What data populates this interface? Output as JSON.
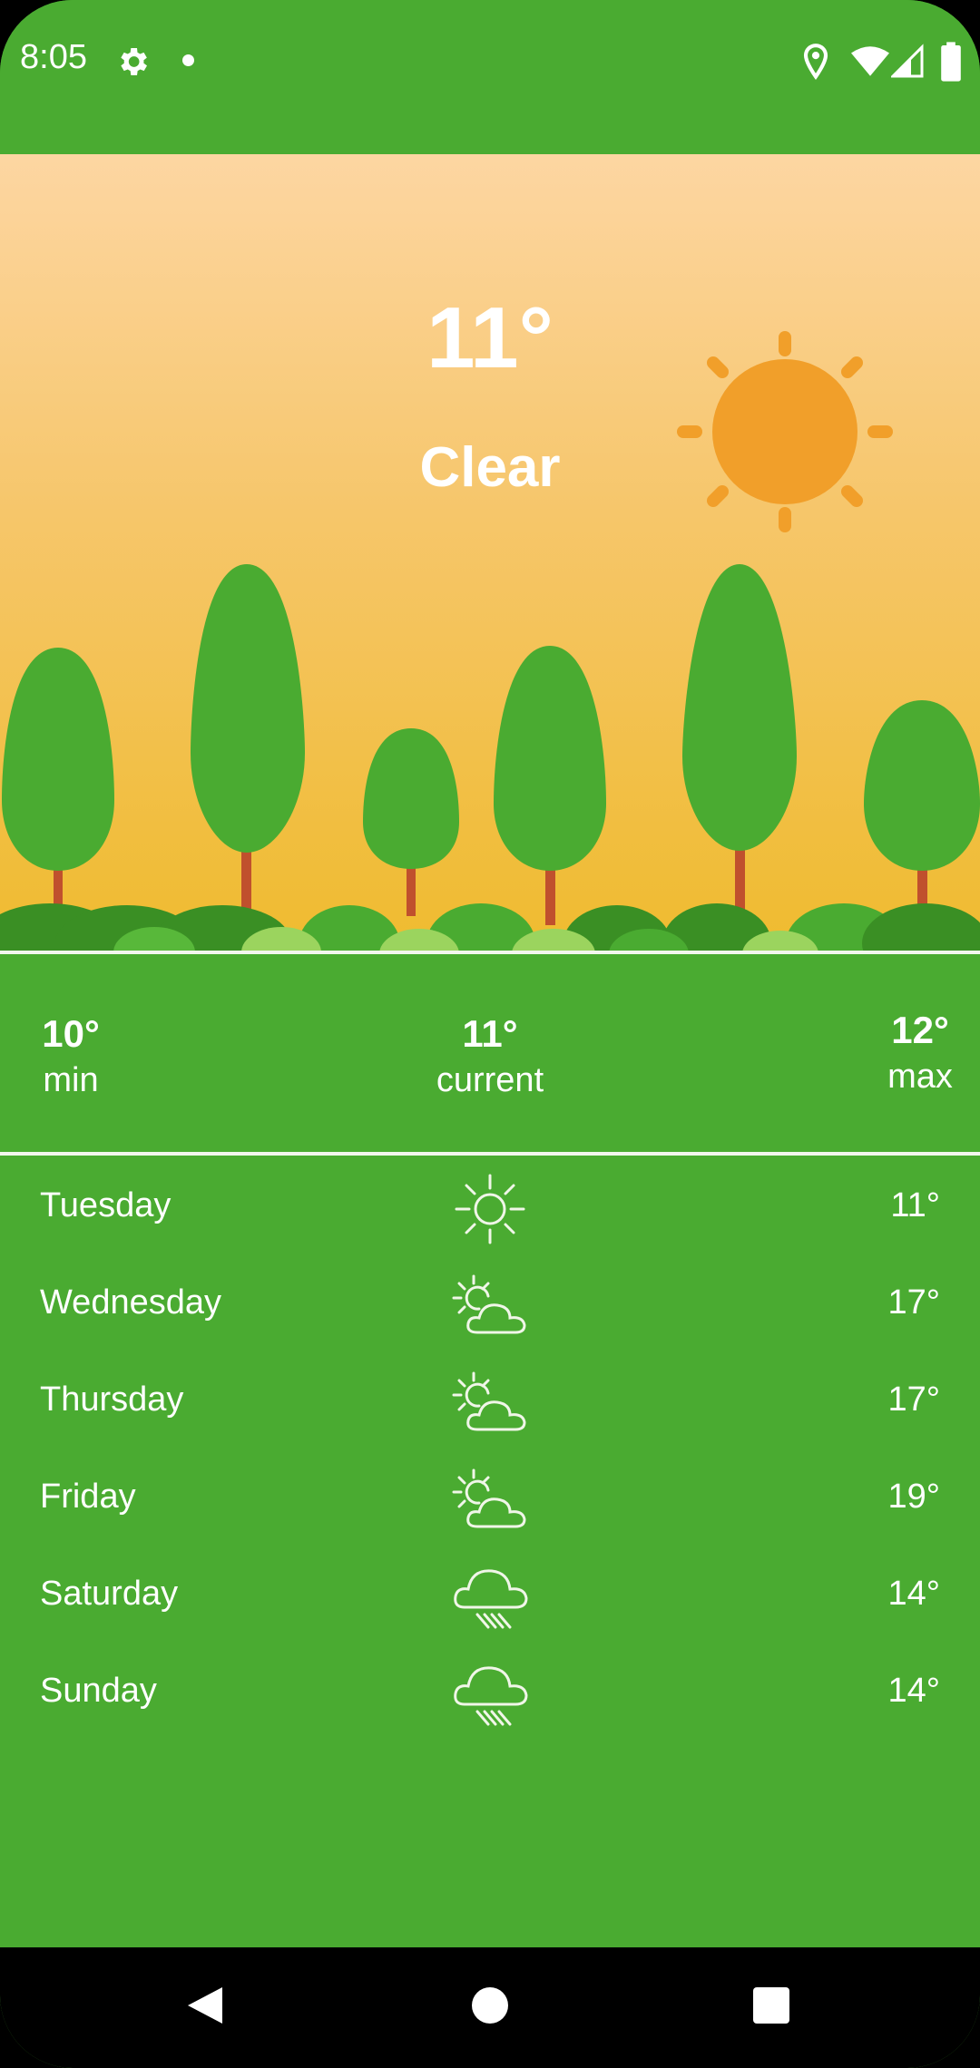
{
  "status_bar": {
    "time": "8:05",
    "icons": [
      "gear-icon",
      "notification-dot-icon",
      "location-icon",
      "wifi-icon",
      "signal-icon",
      "battery-icon"
    ]
  },
  "current": {
    "temperature": "11°",
    "condition": "Clear",
    "condition_icon": "sun-icon"
  },
  "summary": {
    "min_value": "10°",
    "min_label": "min",
    "current_value": "11°",
    "current_label": "current",
    "max_value": "12°",
    "max_label": "max"
  },
  "forecast": [
    {
      "day": "Tuesday",
      "icon": "sun-icon",
      "temp": "11°"
    },
    {
      "day": "Wednesday",
      "icon": "partly-cloudy-icon",
      "temp": "17°"
    },
    {
      "day": "Thursday",
      "icon": "partly-cloudy-icon",
      "temp": "17°"
    },
    {
      "day": "Friday",
      "icon": "partly-cloudy-icon",
      "temp": "19°"
    },
    {
      "day": "Saturday",
      "icon": "rain-icon",
      "temp": "14°"
    },
    {
      "day": "Sunday",
      "icon": "rain-icon",
      "temp": "14°"
    }
  ],
  "nav_bar": {
    "icons": [
      "back-icon",
      "home-icon",
      "recents-icon"
    ]
  },
  "colors": {
    "background": "#4aab31",
    "sun": "#f19f2a",
    "tree": "#4aab31",
    "trunk": "#c0502d",
    "sky_top": "#fdd6a2",
    "sky_bottom": "#efbb2f"
  }
}
